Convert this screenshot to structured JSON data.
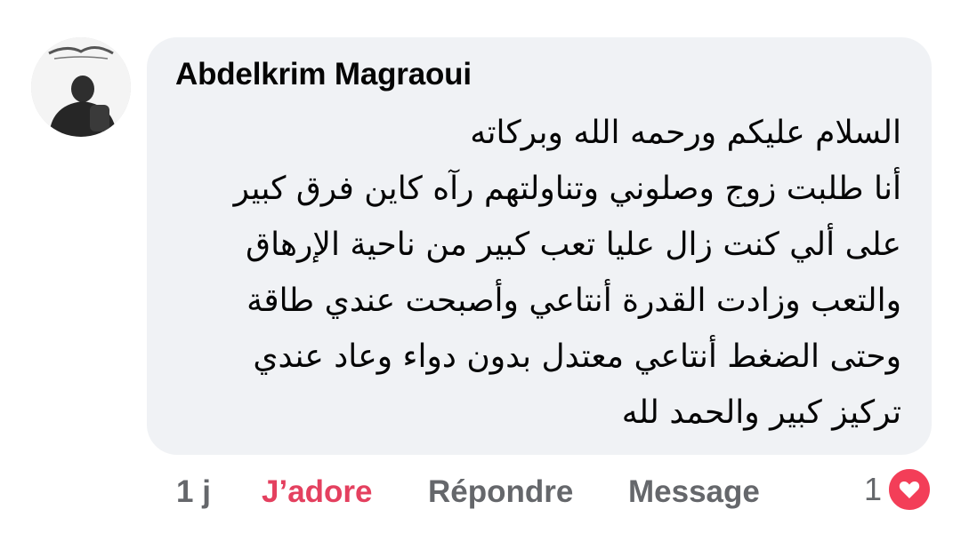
{
  "comment": {
    "author": "Abdelkrim Magraoui",
    "lines": [
      "السلام عليكم ورحمه الله وبركاته",
      "أنا طلبت زوج وصلوني وتناولتهم رآه كاين فرق كبير",
      "على ألي كنت زال عليا تعب كبير من ناحية الإرهاق",
      "والتعب وزادت القدرة أنتاعي وأصبحت عندي طاقة",
      "وحتى الضغط أنتاعي معتدل بدون دواء وعاد عندي",
      "تركيز كبير والحمد لله"
    ]
  },
  "actions": {
    "time": "1 j",
    "react_label": "J’adore",
    "reply_label": "Répondre",
    "message_label": "Message"
  },
  "reactions": {
    "count": "1",
    "icon": "heart-icon"
  },
  "colors": {
    "bubble": "#f0f2f5",
    "reacted": "#e4405f",
    "muted": "#65676b",
    "heart": "#f33e58"
  }
}
